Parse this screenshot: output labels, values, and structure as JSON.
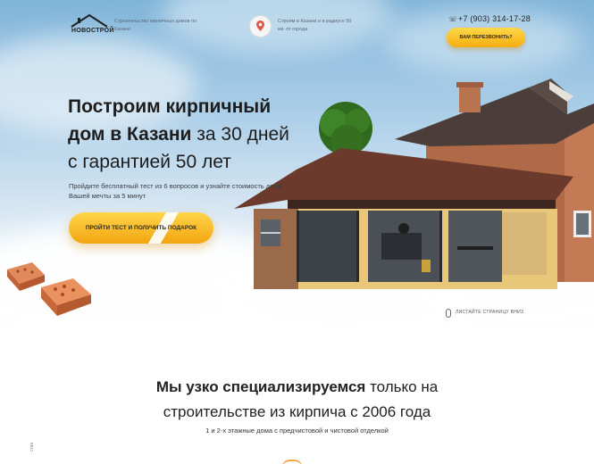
{
  "header": {
    "logo_text": "НОВОСТРОЙ",
    "tagline": "Строительство кирпичных домов по Казани",
    "location_text": "Строим в Казани и в радиусе 50 км. от города",
    "phone": "+7 (903) 314-17-28",
    "callback_label": "ВАМ ПЕРЕЗВОНИТЬ?"
  },
  "hero": {
    "headline_line1": "Построим кирпичный",
    "headline_line2_bold": "дом в Казани",
    "headline_line2_rest": " за 30 дней",
    "headline_line3": "с гарантией 50 лет",
    "subtext": "Пройдите бесплатный тест из 6 вопросов и узнайте стоимость дома Вашей мечты за 5 минут",
    "cta_label": "ПРОЙТИ ТЕСТ И ПОЛУЧИТЬ ПОДАРОК",
    "scroll_hint": "ЛИСТАЙТЕ СТРАНИЦУ ВНИЗ"
  },
  "section": {
    "title_bold": "Мы узко специализируемся",
    "title_rest": " только на",
    "title_line2": "строительстве из кирпича с 2006 года",
    "subtitle": "1 и 2-х этажные дома с предчистовой и чистовой отделкой",
    "side_text": "ства"
  },
  "colors": {
    "accent_yellow": "#f5ad0f",
    "brick": "#c96a3e",
    "text_dark": "#1d1d1d"
  }
}
